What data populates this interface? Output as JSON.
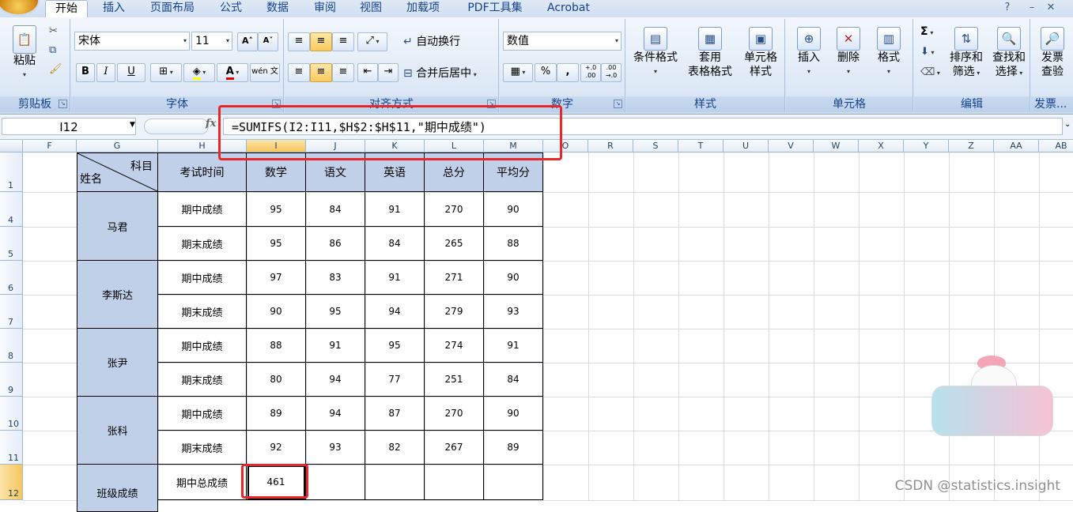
{
  "tabs": [
    "开始",
    "插入",
    "页面布局",
    "公式",
    "数据",
    "审阅",
    "视图",
    "加载项",
    "PDF工具集",
    "Acrobat"
  ],
  "active_tab": "开始",
  "window_controls": [
    "?",
    "–",
    "✕"
  ],
  "ribbon": {
    "clipboard": {
      "paste": "粘贴",
      "label": "剪贴板"
    },
    "font": {
      "name": "宋体",
      "size": "11",
      "label": "字体",
      "bold": "B",
      "italic": "I",
      "underline": "U",
      "grow": "A˄",
      "shrink": "A˅",
      "wen": "wén 文"
    },
    "alignment": {
      "wrap": "自动换行",
      "merge": "合并后居中",
      "label": "对齐方式"
    },
    "number": {
      "format": "数值",
      "percent": "%",
      "comma": ",",
      "inc": "+.0 .00",
      "dec": ".00 →.0",
      "label": "数字"
    },
    "styles": {
      "cond": "条件格式",
      "table1": "套用",
      "table2": "表格格式",
      "cell1": "单元格",
      "cell2": "样式",
      "label": "样式"
    },
    "cells": {
      "insert": "插入",
      "delete": "删除",
      "format": "格式",
      "label": "单元格"
    },
    "editing": {
      "sigma": "Σ",
      "sort1": "排序和",
      "sort2": "筛选",
      "find1": "查找和",
      "find2": "选择",
      "label": "编辑"
    },
    "invoice": {
      "l1": "发票",
      "l2": "查验",
      "label": "发票..."
    }
  },
  "formula_bar": {
    "name_box": "I12",
    "fx": "fx",
    "formula": "=SUMIFS(I2:I11,$H$2:$H$11,\"期中成绩\")"
  },
  "sheet": {
    "columns": [
      "F",
      "G",
      "H",
      "I",
      "J",
      "K",
      "L",
      "M",
      "O",
      "R",
      "S",
      "T",
      "U",
      "V",
      "W",
      "X",
      "Y",
      "Z",
      "AA",
      "AB"
    ],
    "rows": [
      "1",
      "4",
      "5",
      "6",
      "7",
      "8",
      "9",
      "10",
      "11",
      "12"
    ],
    "header": {
      "subject": "科目",
      "name": "姓名",
      "time": "考试时间",
      "math": "数学",
      "chinese": "语文",
      "english": "英语",
      "total": "总分",
      "avg": "平均分"
    },
    "students": [
      {
        "name": "马君",
        "records": [
          {
            "type": "期中成绩",
            "math": "95",
            "chinese": "84",
            "english": "91",
            "total": "270",
            "avg": "90"
          },
          {
            "type": "期末成绩",
            "math": "95",
            "chinese": "86",
            "english": "84",
            "total": "265",
            "avg": "88"
          }
        ]
      },
      {
        "name": "李斯达",
        "records": [
          {
            "type": "期中成绩",
            "math": "97",
            "chinese": "83",
            "english": "91",
            "total": "271",
            "avg": "90"
          },
          {
            "type": "期末成绩",
            "math": "90",
            "chinese": "95",
            "english": "94",
            "total": "279",
            "avg": "93"
          }
        ]
      },
      {
        "name": "张尹",
        "records": [
          {
            "type": "期中成绩",
            "math": "88",
            "chinese": "91",
            "english": "95",
            "total": "274",
            "avg": "91"
          },
          {
            "type": "期末成绩",
            "math": "80",
            "chinese": "94",
            "english": "77",
            "total": "251",
            "avg": "84"
          }
        ]
      },
      {
        "name": "张科",
        "records": [
          {
            "type": "期中成绩",
            "math": "89",
            "chinese": "94",
            "english": "87",
            "total": "270",
            "avg": "90"
          },
          {
            "type": "期末成绩",
            "math": "92",
            "chinese": "93",
            "english": "82",
            "total": "267",
            "avg": "89"
          }
        ]
      }
    ],
    "class_row": {
      "label": "班级成绩",
      "type": "期中总成绩",
      "math": "461"
    }
  },
  "watermark": "CSDN @statistics.insight",
  "colors": {
    "accent": "#e8272b",
    "header_fill": "#c0d0e8",
    "ribbon": "#dbe7f5"
  }
}
